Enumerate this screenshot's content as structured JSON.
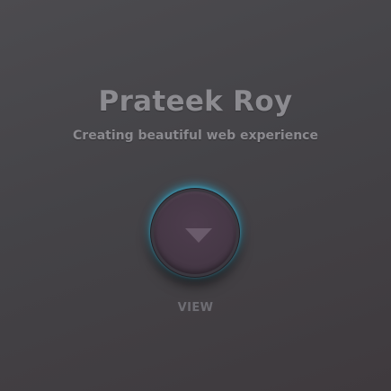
{
  "header": {
    "name": "Prateek Roy",
    "tagline": "Creating beautiful web experience"
  },
  "action": {
    "button_icon": "down-triangle-icon",
    "label": "VIEW"
  },
  "colors": {
    "background": "#464549",
    "text": "#8c8b90",
    "button_face": "#463846",
    "button_glow": "#2ea5c8"
  }
}
